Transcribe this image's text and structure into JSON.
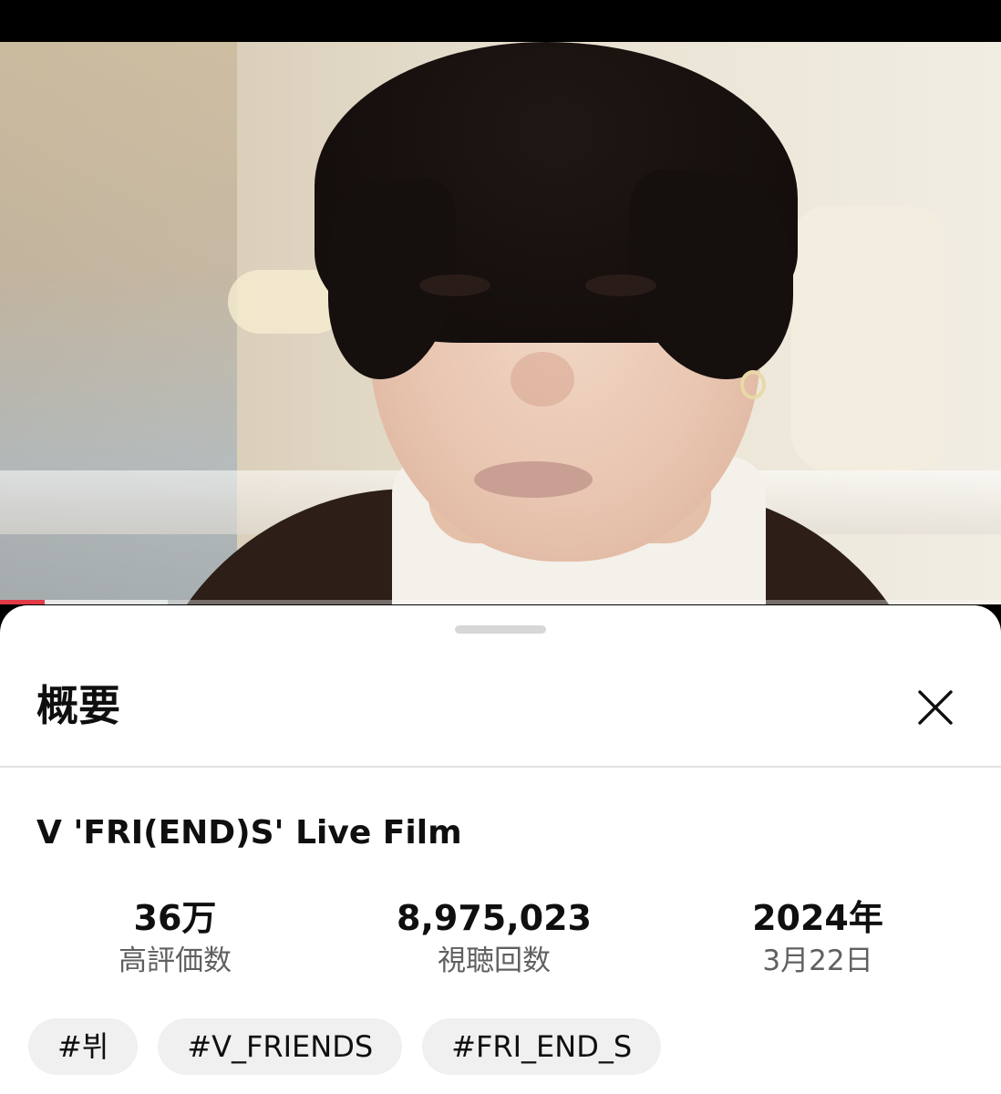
{
  "video": {
    "progress_played_fraction": 0.045,
    "progress_buffered_fraction": 0.168,
    "accent_color": "#e23a47"
  },
  "sheet": {
    "title": "概要",
    "close_icon": "close-icon"
  },
  "description": {
    "video_title": "V 'FRI(END)S' Live Film",
    "stats": {
      "likes_value": "36万",
      "likes_label": "高評価数",
      "views_value": "8,975,023",
      "views_label": "視聴回数",
      "date_value": "2024年",
      "date_label": "3月22日"
    },
    "tags": [
      "#뷔",
      "#V_FRIENDS",
      "#FRI_END_S"
    ]
  }
}
